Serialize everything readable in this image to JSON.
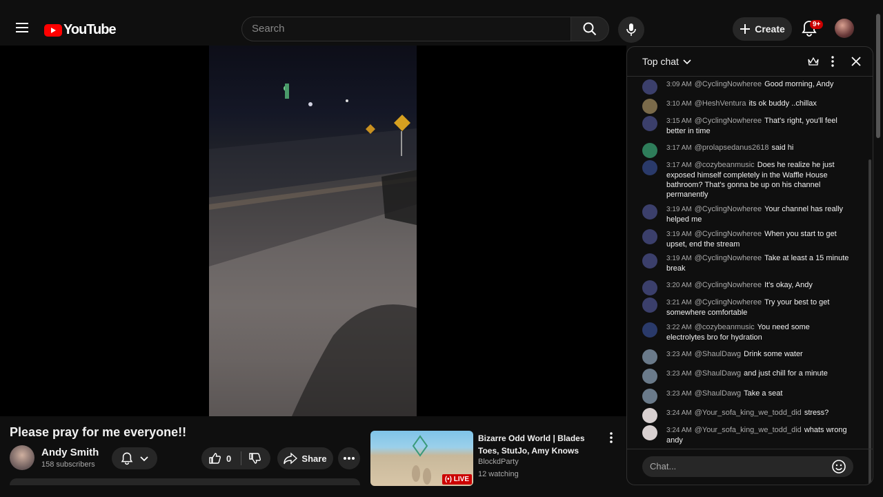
{
  "header": {
    "logo_text": "YouTube",
    "search_placeholder": "Search",
    "create_label": "Create",
    "notification_count": "9+"
  },
  "video": {
    "title": "Please pray for me everyone!!",
    "channel_name": "Andy Smith",
    "subscribers": "158 subscribers",
    "like_count": "0",
    "share_label": "Share"
  },
  "recommendation": {
    "title": "Bizarre Odd World | Blades Toes, StutJo, Amy Knows",
    "channel": "BlockdParty",
    "watching": "12 watching",
    "live_label": "LIVE"
  },
  "chat": {
    "mode_label": "Top chat",
    "input_placeholder": "Chat...",
    "messages": [
      {
        "time": "3:09 AM",
        "author": "@CyclingNowheree",
        "text": "Good morning, Andy",
        "avatar_color": "#3b3f6b"
      },
      {
        "time": "3:10 AM",
        "author": "@HeshVentura",
        "text": "its ok buddy ..chillax",
        "avatar_color": "#7a6a4a"
      },
      {
        "time": "3:15 AM",
        "author": "@CyclingNowheree",
        "text": "That's right, you'll feel better in time",
        "avatar_color": "#3b3f6b"
      },
      {
        "time": "3:17 AM",
        "author": "@prolapsedanus2618",
        "text": "said hi",
        "avatar_color": "#2e7d5a"
      },
      {
        "time": "3:17 AM",
        "author": "@cozybeanmusic",
        "text": "Does he realize he just exposed himself completely in the Waffle House bathroom? That's gonna be up on his channel permanently",
        "avatar_color": "#2a3a6a"
      },
      {
        "time": "3:19 AM",
        "author": "@CyclingNowheree",
        "text": "Your channel has really helped me",
        "avatar_color": "#3b3f6b"
      },
      {
        "time": "3:19 AM",
        "author": "@CyclingNowheree",
        "text": "When you start to get upset, end the stream",
        "avatar_color": "#3b3f6b"
      },
      {
        "time": "3:19 AM",
        "author": "@CyclingNowheree",
        "text": "Take at least a 15 minute break",
        "avatar_color": "#3b3f6b"
      },
      {
        "time": "3:20 AM",
        "author": "@CyclingNowheree",
        "text": "It's okay, Andy",
        "avatar_color": "#3b3f6b"
      },
      {
        "time": "3:21 AM",
        "author": "@CyclingNowheree",
        "text": "Try your best to get somewhere comfortable",
        "avatar_color": "#3b3f6b"
      },
      {
        "time": "3:22 AM",
        "author": "@cozybeanmusic",
        "text": "You need some electrolytes bro for hydration",
        "avatar_color": "#2a3a6a"
      },
      {
        "time": "3:23 AM",
        "author": "@ShaulDawg",
        "text": "Drink some water",
        "avatar_color": "#6a7a8a"
      },
      {
        "time": "3:23 AM",
        "author": "@ShaulDawg",
        "text": "and just chill for a minute",
        "avatar_color": "#6a7a8a"
      },
      {
        "time": "3:23 AM",
        "author": "@ShaulDawg",
        "text": "Take a seat",
        "avatar_color": "#6a7a8a"
      },
      {
        "time": "3:24 AM",
        "author": "@Your_sofa_king_we_todd_did",
        "text": "stress?",
        "avatar_color": "#d8d0d0"
      },
      {
        "time": "3:24 AM",
        "author": "@Your_sofa_king_we_todd_did",
        "text": "whats wrong andy",
        "avatar_color": "#d8d0d0"
      }
    ]
  },
  "colors": {
    "accent_red": "#ff0000",
    "background": "#0f0f0f"
  }
}
